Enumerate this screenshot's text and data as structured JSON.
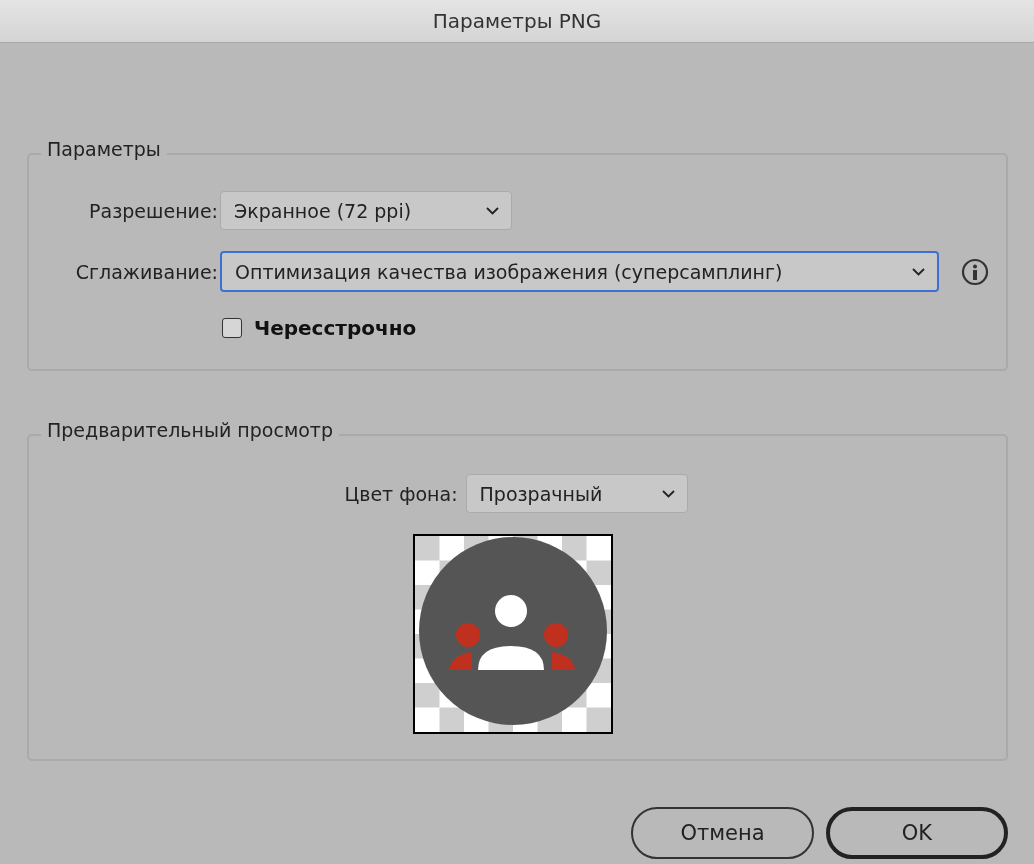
{
  "window": {
    "title": "Параметры PNG"
  },
  "options_group": {
    "legend": "Параметры",
    "resolution": {
      "label": "Разрешение:",
      "value": "Экранное (72 ppi)",
      "focused": false
    },
    "antialiasing": {
      "label": "Сглаживание:",
      "value": "Оптимизация качества изображения (суперсамплинг)",
      "focused": true
    },
    "interlaced": {
      "label": "Чересстрочно",
      "checked": false
    }
  },
  "preview_group": {
    "legend": "Предварительный просмотр",
    "background": {
      "label": "Цвет фона:",
      "value": "Прозрачный",
      "focused": false
    }
  },
  "buttons": [
    {
      "label": "Отмена",
      "default": false
    },
    {
      "label": "OK",
      "default": true
    }
  ]
}
